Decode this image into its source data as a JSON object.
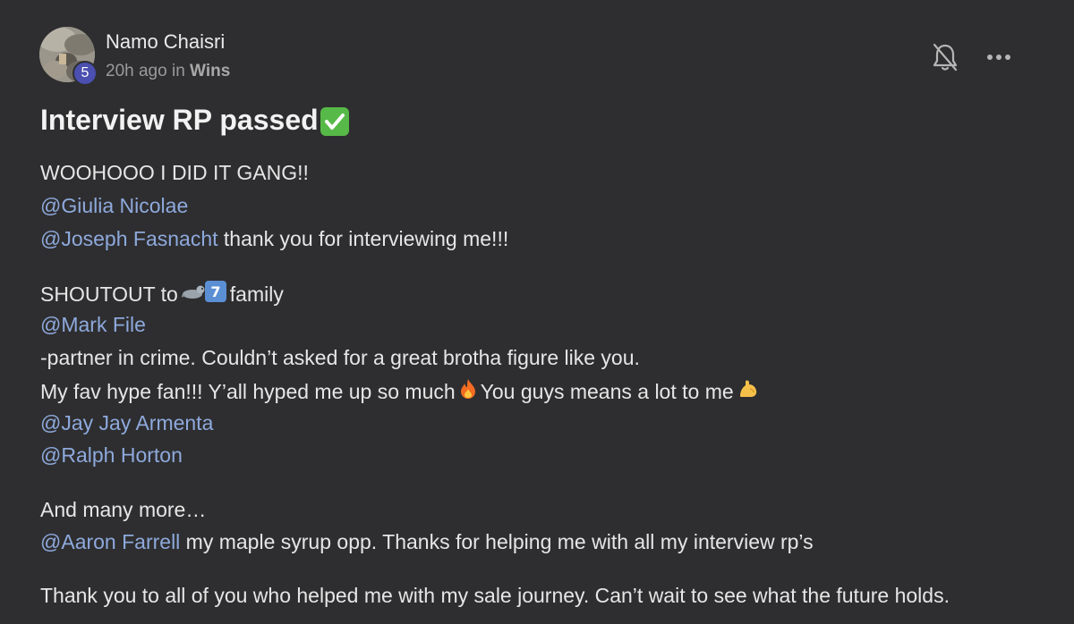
{
  "post": {
    "author": "Namo Chaisri",
    "level": "5",
    "time": "20h ago",
    "in_word": "in",
    "category": "Wins",
    "title": "Interview RP passed",
    "icons": {
      "bell": "bell-off-icon",
      "more": "more-horizontal-icon",
      "check": "check-mark-button-emoji",
      "seal": "seal-emoji",
      "seven": "keycap-seven-emoji",
      "fire": "fire-emoji",
      "muscle": "flexed-biceps-emoji"
    },
    "body": {
      "line1": "WOOHOOO I DID IT GANG!!",
      "mention_giulia": "@Giulia Nicolae",
      "mention_joseph": "@Joseph Fasnacht",
      "line3_rest": " thank you for interviewing me!!!",
      "shoutout_a": "SHOUTOUT to",
      "shoutout_b": "family",
      "mention_mark": "@Mark File",
      "line_partner": "-partner in crime. Couldn’t asked for a great brotha figure like you.",
      "hype_a": "My fav hype fan!!! Y’all hyped me up so much",
      "hype_b": "You guys means a lot to me",
      "mention_jay": "@Jay Jay Armenta",
      "mention_ralph": "@Ralph Horton",
      "many_more": "And many more…",
      "mention_aaron": "@Aaron Farrell",
      "aaron_rest": " my maple syrup opp. Thanks for helping me with all my interview rp’s",
      "thanks": "Thank you to all of you who helped me with my sale journey. Can’t wait to see what the future holds."
    }
  },
  "colors": {
    "background": "#2e2e30",
    "mention": "#8ea9dc",
    "badge": "#4a4fb0",
    "check": "#57b947"
  }
}
